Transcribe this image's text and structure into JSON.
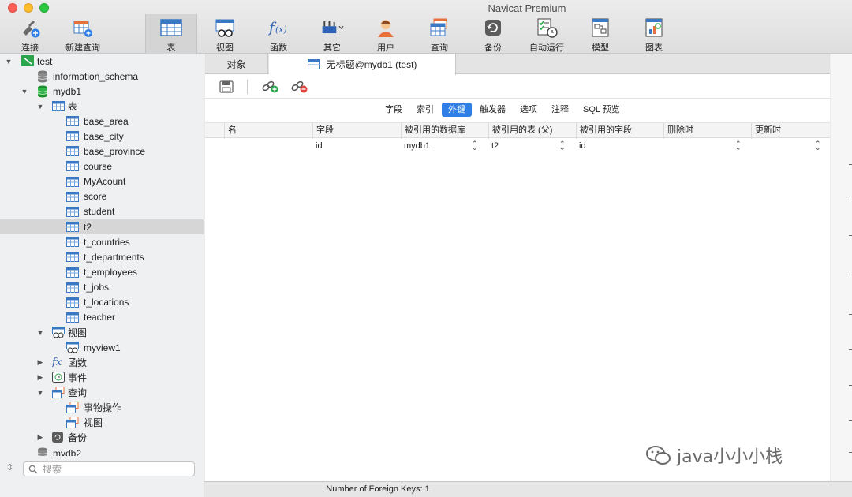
{
  "app_title": "Navicat Premium",
  "toolbar": [
    {
      "label": "连接",
      "icon": "connection-icon"
    },
    {
      "label": "新建查询",
      "icon": "new-query-icon"
    },
    {
      "label": "表",
      "icon": "table-icon"
    },
    {
      "label": "视图",
      "icon": "view-icon"
    },
    {
      "label": "函数",
      "icon": "function-icon"
    },
    {
      "label": "其它",
      "icon": "other-icon"
    },
    {
      "label": "用户",
      "icon": "user-icon"
    },
    {
      "label": "查询",
      "icon": "query-icon"
    },
    {
      "label": "备份",
      "icon": "backup-icon"
    },
    {
      "label": "自动运行",
      "icon": "automation-icon"
    },
    {
      "label": "模型",
      "icon": "model-icon"
    },
    {
      "label": "图表",
      "icon": "chart-icon"
    }
  ],
  "tree": {
    "connection": "test",
    "db_information_schema": "information_schema",
    "db_mydb1": "mydb1",
    "tables_group": "表",
    "tables": [
      "base_area",
      "base_city",
      "base_province",
      "course",
      "MyAcount",
      "score",
      "student",
      "t2",
      "t_countries",
      "t_departments",
      "t_employees",
      "t_jobs",
      "t_locations",
      "teacher"
    ],
    "selected_table": "t2",
    "views_group": "视图",
    "views": [
      "myview1"
    ],
    "functions_group": "函数",
    "events_group": "事件",
    "queries_group": "查询",
    "queries": [
      "事物操作",
      "视图"
    ],
    "backup_group": "备份",
    "db_mydb2": "mydb2"
  },
  "search": {
    "placeholder": "搜索"
  },
  "tabs": {
    "objects": "对象",
    "active": "无标题@mydb1 (test)"
  },
  "segments": [
    "字段",
    "索引",
    "外键",
    "触发器",
    "选项",
    "注释",
    "SQL 预览"
  ],
  "active_segment": "外键",
  "grid": {
    "columns": [
      "名",
      "字段",
      "被引用的数据库",
      "被引用的表 (父)",
      "被引用的字段",
      "删除时",
      "更新时"
    ],
    "rows": [
      {
        "name": "",
        "field": "id",
        "ref_db": "mydb1",
        "ref_table": "t2",
        "ref_field": "id",
        "on_delete": "",
        "on_update": ""
      }
    ]
  },
  "status": "Number of Foreign Keys: 1",
  "watermark": "java小小小栈"
}
